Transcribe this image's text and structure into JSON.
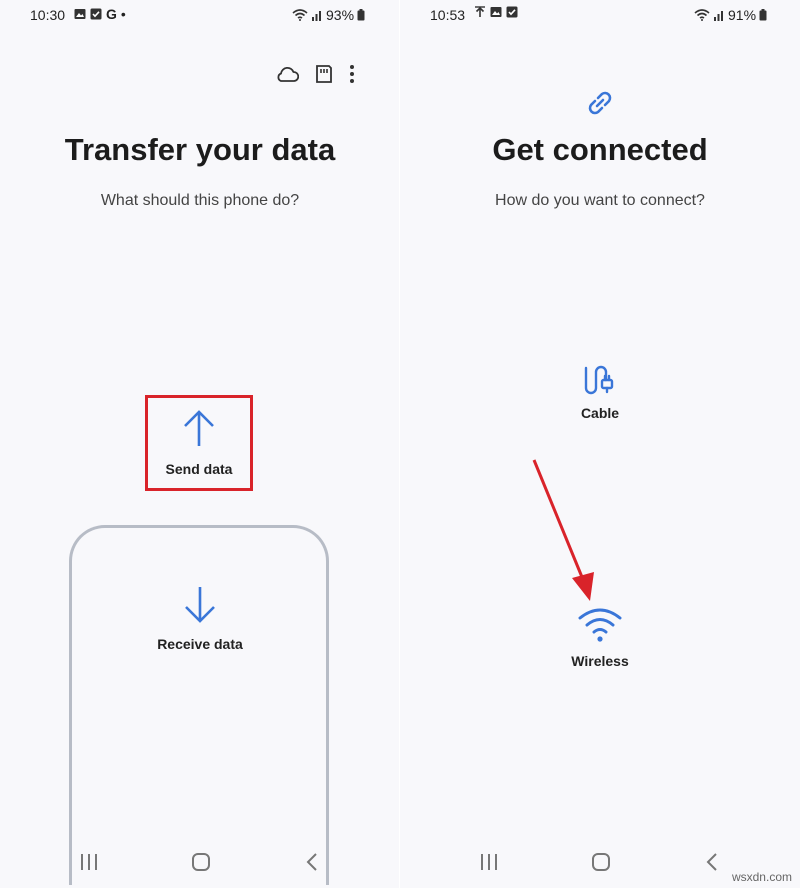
{
  "left_screen": {
    "status": {
      "time": "10:30",
      "letter": "G",
      "dot": "•",
      "battery": "93%"
    },
    "toolbar": {
      "icons": [
        "cloud-icon",
        "sd-card-icon",
        "more-vertical-icon"
      ]
    },
    "title": "Transfer your data",
    "subtitle": "What should this phone do?",
    "options": {
      "send": {
        "label": "Send data",
        "icon": "arrow-up-icon"
      },
      "receive": {
        "label": "Receive data",
        "icon": "arrow-down-icon"
      }
    }
  },
  "right_screen": {
    "status": {
      "time": "10:53",
      "battery": "91%"
    },
    "header_icon": "link-icon",
    "title": "Get connected",
    "subtitle": "How do you want to connect?",
    "options": {
      "cable": {
        "label": "Cable",
        "icon": "cable-icon"
      },
      "wireless": {
        "label": "Wireless",
        "icon": "wifi-icon"
      }
    }
  },
  "watermark": "wsxdn.com",
  "colors": {
    "accent": "#3a76d8",
    "highlight": "#d9232a"
  }
}
